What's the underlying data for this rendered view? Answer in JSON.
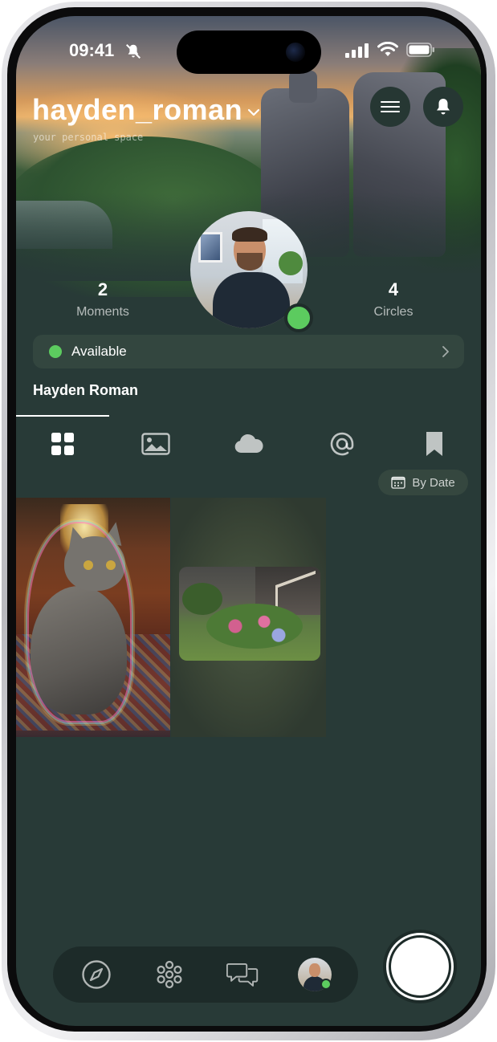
{
  "status_bar": {
    "time": "09:41"
  },
  "profile": {
    "username": "hayden_roman",
    "tagline": "your personal space",
    "display_name": "Hayden Roman",
    "status": "Available"
  },
  "stats": {
    "moments": {
      "count": "2",
      "label": "Moments"
    },
    "circles": {
      "count": "4",
      "label": "Circles"
    }
  },
  "tabs": [
    "grid-icon",
    "image-icon",
    "cloud-icon",
    "at-icon",
    "bookmark-icon"
  ],
  "sort": {
    "label": "By Date"
  },
  "nav": [
    "compass-icon",
    "flower-icon",
    "chat-icon",
    "profile-avatar"
  ],
  "colors": {
    "background": "#283a37",
    "presence": "#5ccb5f",
    "pill": "#33463f",
    "nav": "#1d2b29"
  }
}
